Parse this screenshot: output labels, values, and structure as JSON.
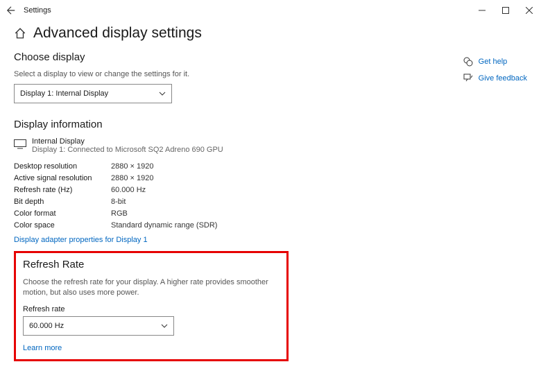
{
  "window": {
    "title": "Settings"
  },
  "page": {
    "title": "Advanced display settings",
    "chooseDisplay": {
      "heading": "Choose display",
      "subtext": "Select a display to view or change the settings for it.",
      "selected": "Display 1: Internal Display"
    },
    "displayInfo": {
      "heading": "Display information",
      "name": "Internal Display",
      "connection": "Display 1: Connected to Microsoft SQ2 Adreno 690 GPU",
      "rows": [
        {
          "label": "Desktop resolution",
          "value": "2880 × 1920"
        },
        {
          "label": "Active signal resolution",
          "value": "2880 × 1920"
        },
        {
          "label": "Refresh rate (Hz)",
          "value": "60.000 Hz"
        },
        {
          "label": "Bit depth",
          "value": "8-bit"
        },
        {
          "label": "Color format",
          "value": "RGB"
        },
        {
          "label": "Color space",
          "value": "Standard dynamic range (SDR)"
        }
      ],
      "adapterLink": "Display adapter properties for Display 1"
    },
    "refreshRate": {
      "heading": "Refresh Rate",
      "desc": "Choose the refresh rate for your display. A higher rate provides smoother motion, but also uses more power.",
      "fieldLabel": "Refresh rate",
      "selected": "60.000 Hz",
      "learnMore": "Learn more"
    }
  },
  "side": {
    "help": "Get help",
    "feedback": "Give feedback"
  }
}
